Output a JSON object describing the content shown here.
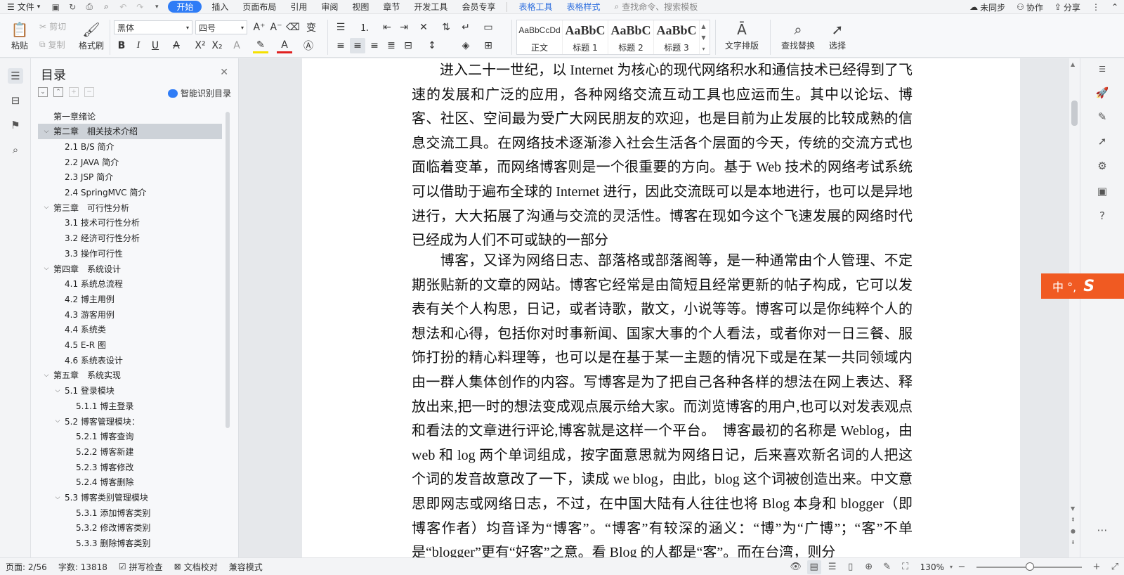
{
  "menubar": {
    "file": "文件",
    "tabs": [
      "开始",
      "插入",
      "页面布局",
      "引用",
      "审阅",
      "视图",
      "章节",
      "开发工具",
      "会员专享"
    ],
    "context_tabs": [
      "表格工具",
      "表格样式"
    ],
    "search_placeholder": "查找命令、搜索模板",
    "right": [
      "未同步",
      "协作",
      "分享"
    ]
  },
  "ribbon": {
    "paste": "粘贴",
    "cut": "剪切",
    "copy": "复制",
    "format_painter": "格式刷",
    "font_name": "黑体",
    "font_size": "四号",
    "styles": [
      {
        "sample": "AaBbCcDd",
        "name": "正文"
      },
      {
        "sample": "AaBbC",
        "name": "标题 1"
      },
      {
        "sample": "AaBbC",
        "name": "标题 2"
      },
      {
        "sample": "AaBbC",
        "name": "标题 3"
      }
    ],
    "text_layout": "文字排版",
    "find_replace": "查找替换",
    "select": "选择"
  },
  "toc": {
    "title": "目录",
    "smart_label": "智能识别目录",
    "items": [
      {
        "label": "第一章绪论",
        "level": 1,
        "toggle": ""
      },
      {
        "label": "第二章　相关技术介绍",
        "level": 1,
        "toggle": "⌵",
        "selected": true
      },
      {
        "label": "2.1 B/S  简介",
        "level": 2,
        "toggle": ""
      },
      {
        "label": "2.2 JAVA  简介",
        "level": 2,
        "toggle": ""
      },
      {
        "label": "2.3 JSP  简介",
        "level": 2,
        "toggle": ""
      },
      {
        "label": "2.4 SpringMVC 简介",
        "level": 2,
        "toggle": ""
      },
      {
        "label": "第三章　可行性分析",
        "level": 1,
        "toggle": "⌵"
      },
      {
        "label": "3.1  技术可行性分析",
        "level": 2,
        "toggle": ""
      },
      {
        "label": "3.2  经济可行性分析",
        "level": 2,
        "toggle": ""
      },
      {
        "label": "3.3  操作可行性",
        "level": 2,
        "toggle": ""
      },
      {
        "label": "第四章　系统设计",
        "level": 1,
        "toggle": "⌵"
      },
      {
        "label": "4.1  系统总流程",
        "level": 2,
        "toggle": ""
      },
      {
        "label": "4.2  博主用例",
        "level": 2,
        "toggle": ""
      },
      {
        "label": "4.3  游客用例",
        "level": 2,
        "toggle": ""
      },
      {
        "label": "4.4  系统类",
        "level": 2,
        "toggle": ""
      },
      {
        "label": "4.5 E-R 图",
        "level": 2,
        "toggle": ""
      },
      {
        "label": "4.6  系统表设计",
        "level": 2,
        "toggle": ""
      },
      {
        "label": "第五章　系统实现",
        "level": 1,
        "toggle": "⌵"
      },
      {
        "label": "5.1  登录模块",
        "level": 2,
        "toggle": "⌵"
      },
      {
        "label": "5.1.1  博主登录",
        "level": 3,
        "toggle": ""
      },
      {
        "label": "5.2  博客管理模块：",
        "level": 2,
        "toggle": "⌵"
      },
      {
        "label": "5.2.1  博客查询",
        "level": 3,
        "toggle": ""
      },
      {
        "label": "5.2.2  博客新建",
        "level": 3,
        "toggle": ""
      },
      {
        "label": "5.2.3  博客修改",
        "level": 3,
        "toggle": ""
      },
      {
        "label": "5.2.4  博客删除",
        "level": 3,
        "toggle": ""
      },
      {
        "label": "5.3  博客类别管理模块",
        "level": 2,
        "toggle": "⌵"
      },
      {
        "label": "5.3.1  添加博客类别",
        "level": 3,
        "toggle": ""
      },
      {
        "label": "5.3.2  修改博客类别",
        "level": 3,
        "toggle": ""
      },
      {
        "label": "5.3.3  删除博客类别",
        "level": 3,
        "toggle": ""
      }
    ]
  },
  "document": {
    "paragraph1": "　　进入二十一世纪，以 Internet 为核心的现代网络积水和通信技术已经得到了飞速的发展和广泛的应用，各种网络交流互动工具也应运而生。其中以论坛、博客、社区、空间最为受广大网民朋友的欢迎，也是目前为止发展的比较成熟的信息交流工具。在网络技术逐渐渗入社会生活各个层面的今天，传统的交流方式也面临着变革，而网络博客则是一个很重要的方向。基于 Web 技术的网络考试系统可以借助于遍布全球的 Internet 进行，因此交流既可以是本地进行，也可以是异地进行，大大拓展了沟通与交流的灵活性。博客在现如今这个飞速发展的网络时代已经成为人们不可或缺的一部分",
    "paragraph2": "　　博客，又译为网络日志、部落格或部落阁等，是一种通常由个人管理、不定期张贴新的文章的网站。博客它经常是由简短且经常更新的帖子构成，它可以发表有关个人构思，日记，或者诗歌，散文，小说等等。博客可以是你纯粹个人的想法和心得，包括你对时事新闻、国家大事的个人看法，或者你对一日三餐、服饰打扮的精心料理等，也可以是在基于某一主题的情况下或是在某一共同领域内由一群人集体创作的内容。写博客是为了把自己各种各样的想法在网上表达、释放出来,把一时的想法变成观点展示给大家。而浏览博客的用户,也可以对发表观点和看法的文章进行评论,博客就是这样一个平台。　博客最初的名称是 Weblog，由 web 和 log 两个单词组成，按字面意思就为网络日记，后来喜欢新名词的人把这个词的发音故意改了一下，读成 we blog，由此，blog 这个词被创造出来。中文意思即网志或网络日志，不过，在中国大陆有人往往也将 Blog 本身和 blogger（即博客作者）均音译为“博客”。“博客”有较深的涵义：“博”为“广博”；“客”不单是“blogger”更有“好客”之意。看 Blog 的人都是“客”。而在台湾，则分"
  },
  "ime": {
    "label": "中 °,",
    "logo": "S"
  },
  "statusbar": {
    "page": "页面: 2/56",
    "words": "字数: 13818",
    "spell": "拼写检查",
    "proof": "文档校对",
    "compat": "兼容模式",
    "zoom": "130%",
    "zoom_value": 130
  }
}
